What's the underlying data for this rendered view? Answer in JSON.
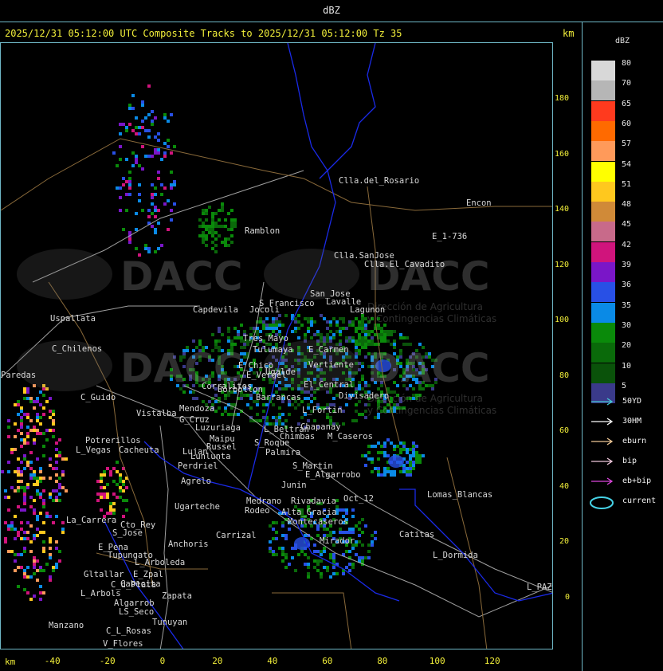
{
  "window_title": "dBZ",
  "header": "2025/12/31 05:12:00 UTC Composite Tracks to 2025/12/31 05:12:00 Tz 35",
  "km_unit_top": "km",
  "km_unit_bottom": "km",
  "legend": {
    "title": "dBZ",
    "scale": [
      {
        "label": "80",
        "color": "#d8d8d8"
      },
      {
        "label": "70",
        "color": "#b6b6b6"
      },
      {
        "label": "65",
        "color": "#ff3a1e"
      },
      {
        "label": "60",
        "color": "#ff6a00"
      },
      {
        "label": "57",
        "color": "#ff9a5a"
      },
      {
        "label": "54",
        "color": "#ffff00"
      },
      {
        "label": "51",
        "color": "#ffc81e"
      },
      {
        "label": "48",
        "color": "#d08a38"
      },
      {
        "label": "45",
        "color": "#c86a8a"
      },
      {
        "label": "42",
        "color": "#d0147c"
      },
      {
        "label": "39",
        "color": "#7a16c8"
      },
      {
        "label": "36",
        "color": "#2850e6"
      },
      {
        "label": "35",
        "color": "#0a8ae6"
      },
      {
        "label": "30",
        "color": "#0a8a0a"
      },
      {
        "label": "20",
        "color": "#0a6a0a"
      },
      {
        "label": "10",
        "color": "#0a520a"
      },
      {
        "label": "5",
        "color": "#3a3a8a"
      }
    ],
    "tracks": [
      {
        "label": "50YD",
        "color": "#46c8d2"
      },
      {
        "label": "30HM",
        "color": "#ffffff"
      },
      {
        "label": "eburn",
        "color": "#f0c896"
      },
      {
        "label": "bip",
        "color": "#f0c8dc"
      },
      {
        "label": "eb+bip",
        "color": "#dc46dc"
      },
      {
        "label": "current",
        "color": "#46d2e6"
      }
    ]
  },
  "y_axis_ticks": [
    "180",
    "160",
    "140",
    "120",
    "100",
    "80",
    "60",
    "40",
    "20",
    "0"
  ],
  "x_axis_ticks": [
    "-40",
    "-20",
    "0",
    "20",
    "40",
    "60",
    "80",
    "100",
    "120"
  ],
  "watermark": {
    "text": "DACC",
    "line1": "Dirección de Agricultura",
    "line2": "y Contingencias Climáticas"
  },
  "places": [
    "Clla.del_Rosario",
    "Encon",
    "E_1-736",
    "Ramblon",
    "Clla.SanJose",
    "Clla.El_Cavadito",
    "Uspallata",
    "S_Francisco",
    "San_Jose",
    "Lagunon",
    "C_Chilenos",
    "Tres_Mayo",
    "E_Carmen",
    "C_Guido",
    "Vertiente",
    "Ugalde",
    "Divisadero",
    "L_Fortin",
    "Mendoza",
    "G_Cruz",
    "Luzuriaga",
    "Potrerillos",
    "L_Vegas",
    "Cacheuta",
    "Russel",
    "Perdriel",
    "S_Martin",
    "Agrelo",
    "La_Carrera",
    "Cto_Rey",
    "S_Jose",
    "Ugarteche",
    "Carrizal",
    "Medrano",
    "Rivadavia",
    "Lomas_Blancas",
    "E_Pena",
    "Tupungato",
    "Anchoris",
    "Catitas",
    "Mirador",
    "L_Dormida",
    "Gltallar",
    "E_Zpal",
    "L_Arboleda",
    "C_d_Plata",
    "L_Arbols",
    "Zapata",
    "Algarrob",
    "LS_Seco",
    "Tunuyan",
    "Manzano",
    "C_L_Rosas",
    "V_Flores",
    "L_PAZ",
    "Capdevila",
    "Jocoli",
    "Lavalle",
    "E_Chico",
    "Tulumaya",
    "El_Central",
    "Barrancas",
    "S_Roque",
    "Palmira",
    "Chimbas",
    "M_Caseros",
    "Junin",
    "Paredas",
    "E_Vergel",
    "Corralitos",
    "Chapanay",
    "L_Beltran",
    "E_Algarrobo",
    "Oct_12",
    "Lujan",
    "Maipu",
    "Lunlunta",
    "Vistalba",
    "Rodeo",
    "Alta_Gracia",
    "Borbollon",
    "Montecaseros",
    "Cabecita"
  ]
}
